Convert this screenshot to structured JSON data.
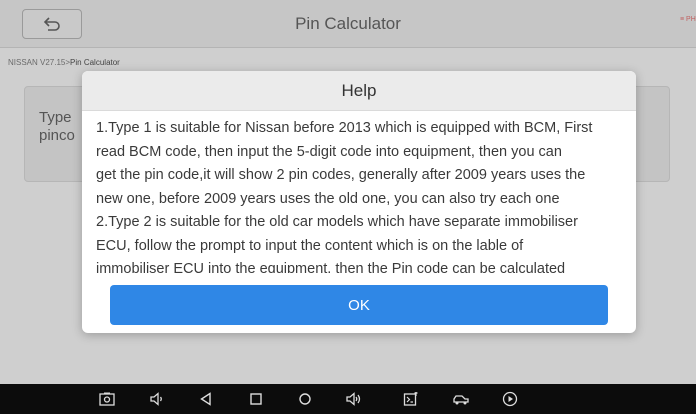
{
  "app": {
    "title": "Pin Calculator",
    "corner_logo": "≡ PH",
    "breadcrumb_prefix": "NISSAN V27.15>",
    "breadcrumb_current": "Pin Calculator",
    "bg_label_line1": "Type",
    "bg_label_line2": "pinco"
  },
  "dialog": {
    "title": "Help",
    "lines": [
      "1.Type 1 is suitable for Nissan before 2013 which is equipped with BCM, First",
      "read BCM code, then input the 5-digit code into equipment, then you can",
      "get the pin code,it will show 2 pin codes, generally after 2009 years uses the",
      "new one, before 2009 years uses the old one, you can also try each one",
      "2.Type 2 is suitable for the old car models which have separate immobiliser",
      "ECU, follow the prompt to input the content which is on the lable of",
      "immobiliser ECU into the equipment, then the Pin code can be calculated"
    ],
    "ok_label": "OK"
  },
  "navbar": {
    "icons": [
      "screenshot-icon",
      "volume-down-icon",
      "back-icon",
      "home-icon",
      "circle-icon",
      "volume-up-icon",
      "vci-icon",
      "car-icon",
      "play-icon"
    ]
  },
  "colors": {
    "ok_button": "#2f87e6",
    "navbar": "#0c0c0c",
    "overlay_background": "#cfcfcf"
  }
}
